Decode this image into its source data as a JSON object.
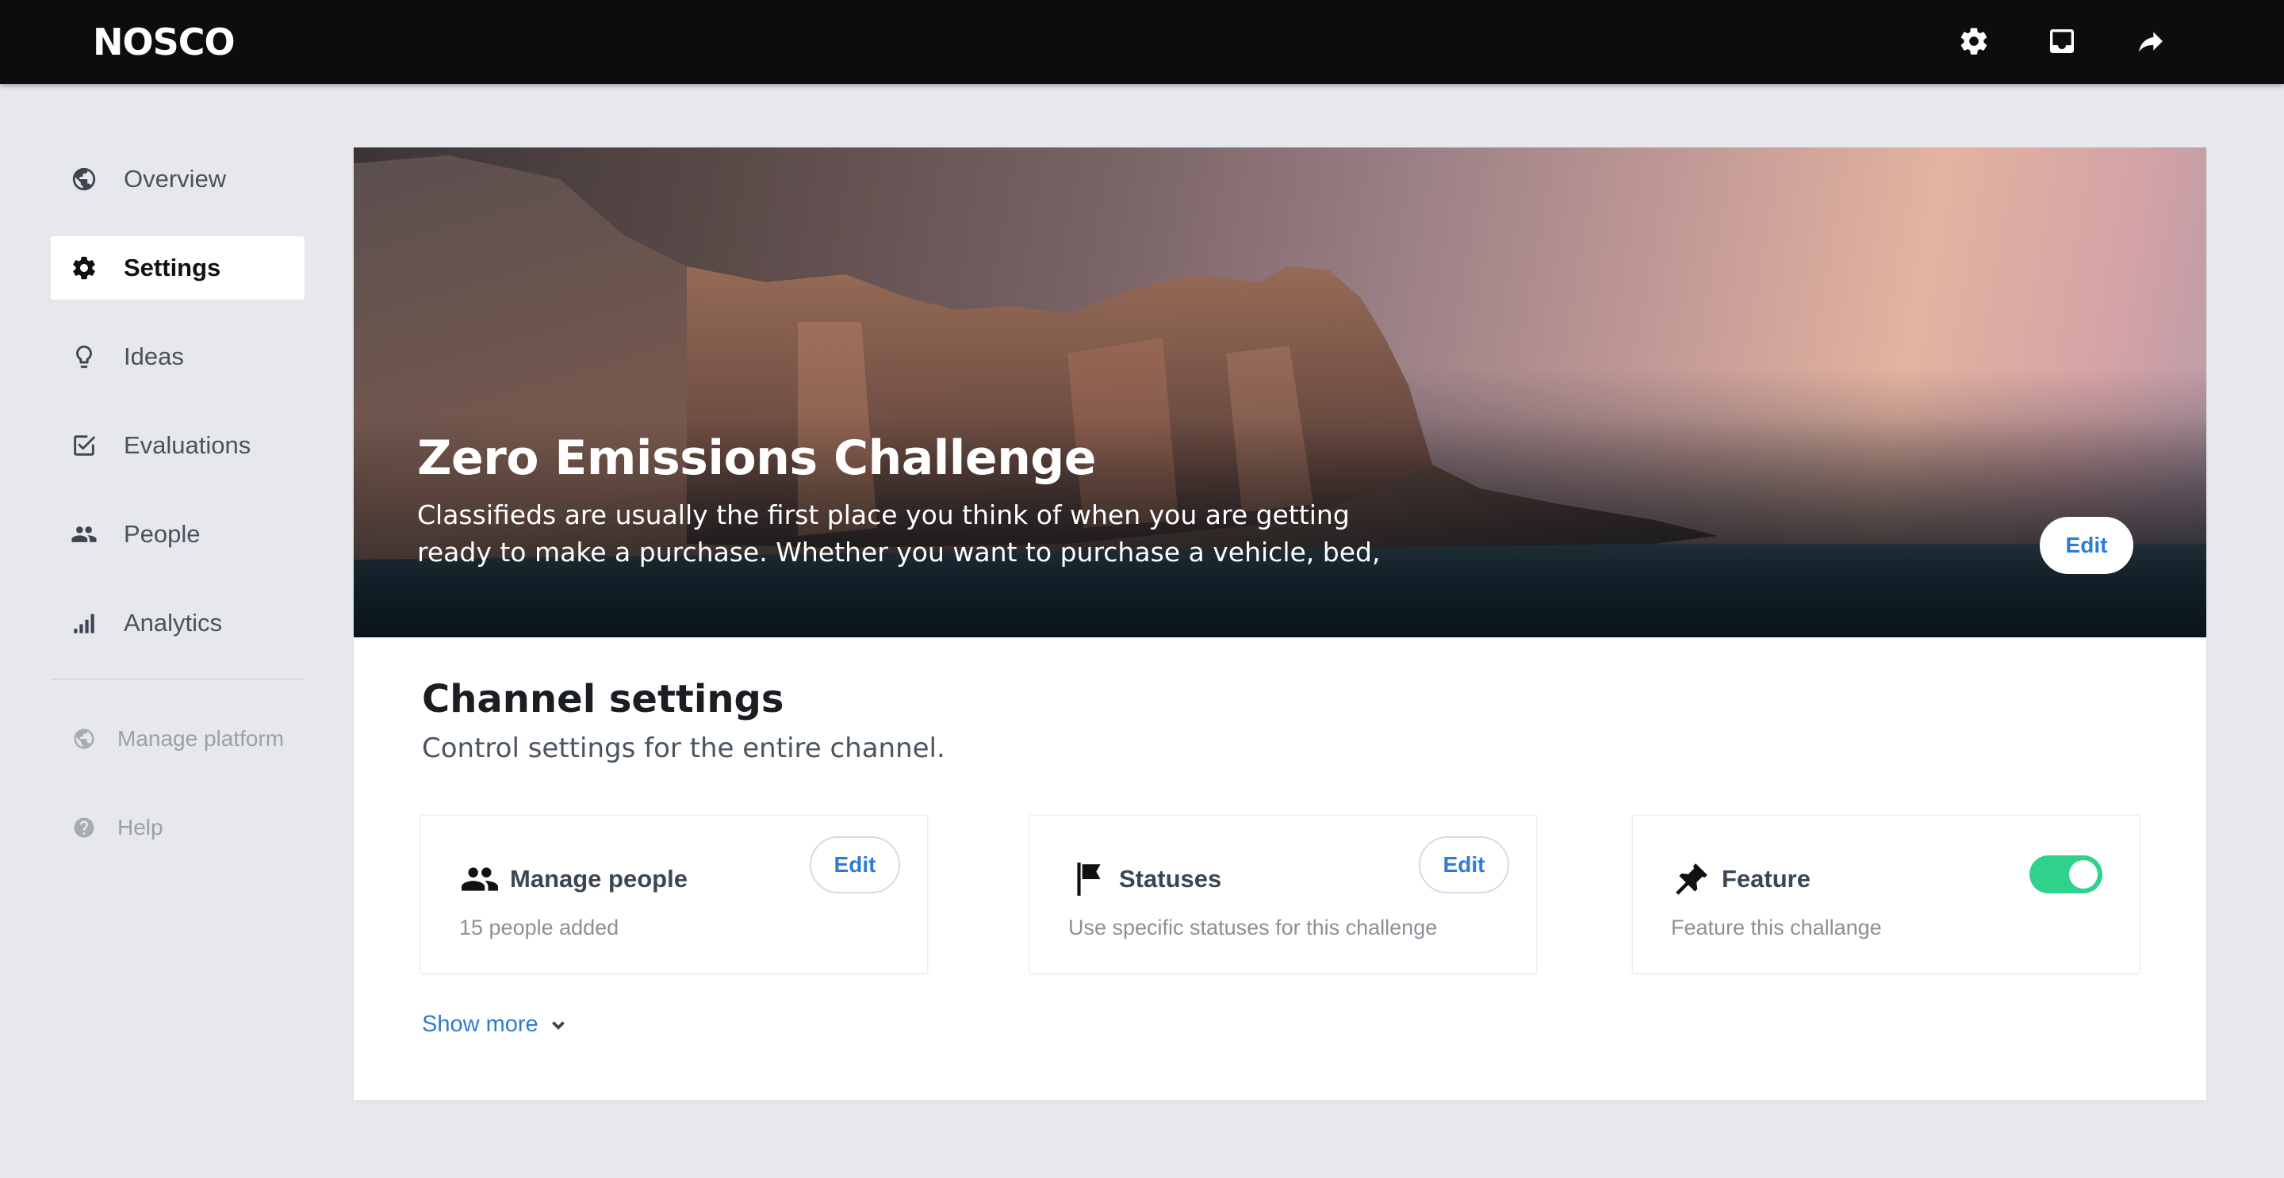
{
  "app": {
    "logo": "NOSCO"
  },
  "topbar": {
    "icons": [
      "gear-icon",
      "inbox-icon",
      "share-icon"
    ]
  },
  "sidebar": {
    "items": [
      {
        "label": "Overview",
        "icon": "globe-icon",
        "active": false
      },
      {
        "label": "Settings",
        "icon": "gear-icon",
        "active": true
      },
      {
        "label": "Ideas",
        "icon": "lightbulb-icon",
        "active": false
      },
      {
        "label": "Evaluations",
        "icon": "checkbox-icon",
        "active": false
      },
      {
        "label": "People",
        "icon": "people-icon",
        "active": false
      },
      {
        "label": "Analytics",
        "icon": "bar-chart-icon",
        "active": false
      }
    ],
    "secondary": [
      {
        "label": "Manage platform",
        "icon": "globe-icon"
      },
      {
        "label": "Help",
        "icon": "help-icon"
      }
    ]
  },
  "hero": {
    "title": "Zero Emissions Challenge",
    "description": "Classifieds are usually the first place you think of when you are getting ready to make a purchase. Whether you want to purchase a vehicle, bed,",
    "edit_label": "Edit"
  },
  "channel_settings": {
    "title": "Channel settings",
    "subtitle": "Control settings for the entire channel.",
    "cards": [
      {
        "title": "Manage people",
        "description": "15 people added",
        "icon": "people-icon",
        "action": "Edit"
      },
      {
        "title": "Statuses",
        "description": "Use specific statuses for this challenge",
        "icon": "flag-icon",
        "action": "Edit"
      },
      {
        "title": "Feature",
        "description": "Feature this challange",
        "icon": "pin-icon",
        "toggle_on": true
      }
    ],
    "show_more": "Show more"
  },
  "colors": {
    "accent": "#2e7bd6",
    "toggle_on": "#2fd28a",
    "topbar": "#0d0d0d",
    "background": "#e7e8ec"
  }
}
